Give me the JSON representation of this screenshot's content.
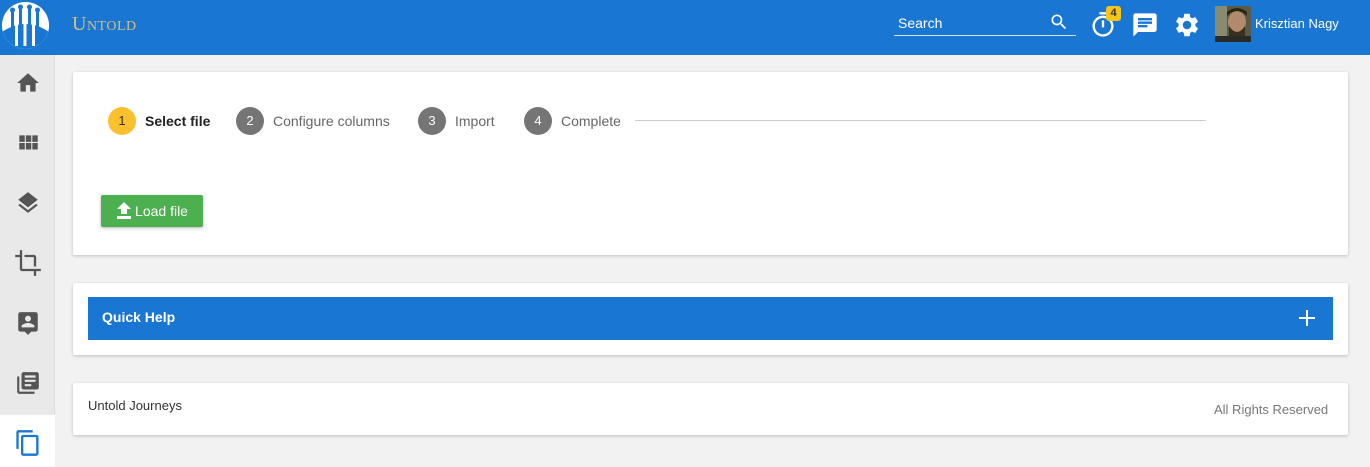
{
  "header": {
    "brand": "Untold",
    "search_placeholder": "Search",
    "timer_badge": "4",
    "username": "Krisztian Nagy"
  },
  "sidebar": {
    "items": [
      {
        "icon": "home-icon"
      },
      {
        "icon": "grid-icon"
      },
      {
        "icon": "layers-icon"
      },
      {
        "icon": "crop-icon"
      },
      {
        "icon": "contact-icon"
      },
      {
        "icon": "library-books-icon"
      },
      {
        "icon": "copy-icon",
        "active": true
      }
    ]
  },
  "wizard": {
    "steps": [
      {
        "number": "1",
        "label": "Select file",
        "active": true
      },
      {
        "number": "2",
        "label": "Configure columns"
      },
      {
        "number": "3",
        "label": "Import"
      },
      {
        "number": "4",
        "label": "Complete"
      }
    ],
    "load_button": "Load file"
  },
  "help": {
    "title": "Quick Help"
  },
  "footer": {
    "left": "Untold Journeys",
    "right": "All Rights Reserved"
  },
  "colors": {
    "primary": "#1976d2",
    "active_step": "#fbc02d",
    "inactive_step": "#757575",
    "success": "#4caf50"
  }
}
